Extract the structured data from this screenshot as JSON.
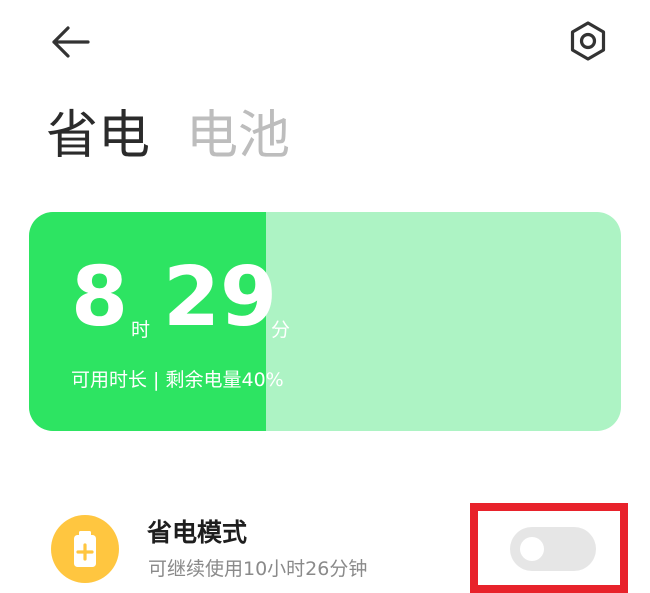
{
  "header": {
    "back_icon": "arrow-left-icon",
    "settings_icon": "gear-icon"
  },
  "tabs": [
    {
      "label": "省电",
      "active": true
    },
    {
      "label": "电池",
      "active": false
    }
  ],
  "battery_card": {
    "hours": "8",
    "hours_unit": "时",
    "minutes": "29",
    "minutes_unit": "分",
    "caption": "可用时长 | 剩余电量40%",
    "charge_fraction": 0.4,
    "fill_color": "#2de462",
    "track_color": "#adf3c4"
  },
  "power_saving": {
    "icon": "battery-plus-icon",
    "icon_color": "#ffc640",
    "title": "省电模式",
    "description": "可继续使用10小时26分钟",
    "toggle_on": false,
    "highlight_color": "#e8222b"
  }
}
